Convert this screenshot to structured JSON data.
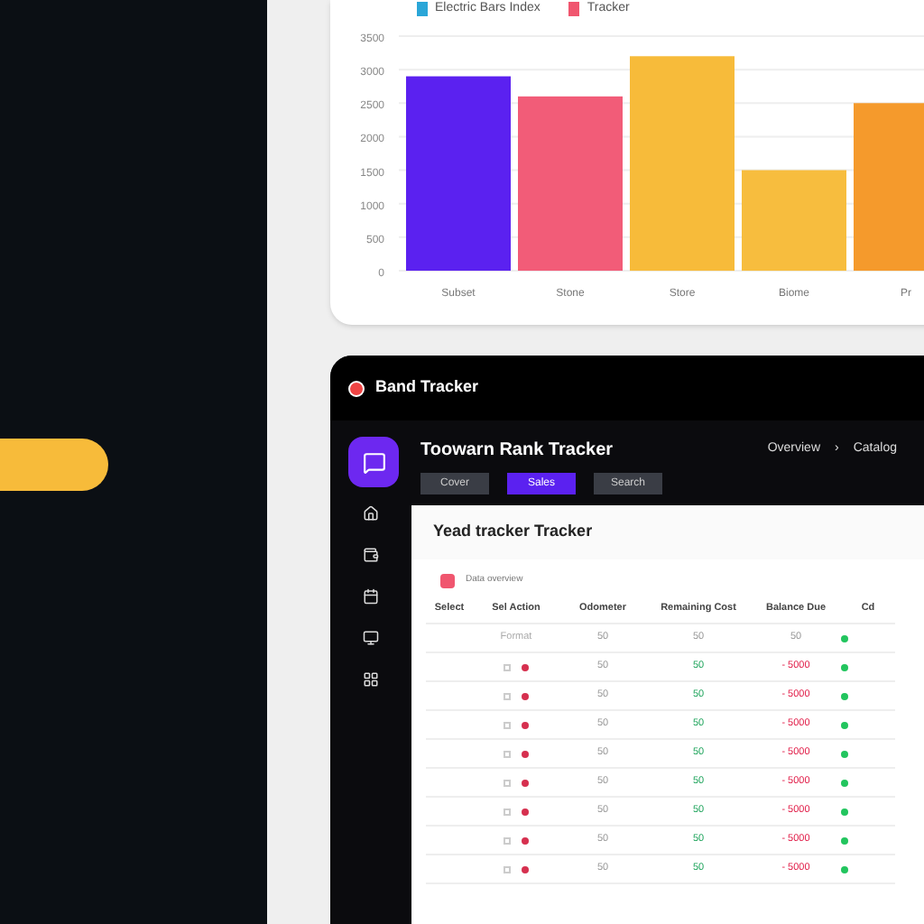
{
  "chart_card": {
    "legend": [
      {
        "label": "Electric Bars Index",
        "color": "#2aa6d8"
      }
    ],
    "series_swatch": {
      "color": "#f0566f"
    },
    "bars": [
      {
        "color": "#5b21f0"
      },
      {
        "color": "#f25c78"
      },
      {
        "color": "#f7bb3a"
      },
      {
        "color": "#f7bd3e"
      },
      {
        "color": "#f59a2c"
      }
    ],
    "chart_data": {
      "type": "bar",
      "categories": [
        "Subset",
        "Stone",
        "Store",
        "Biome",
        "Pr"
      ],
      "series": [
        {
          "name": "Tracker",
          "values": [
            2900,
            2600,
            3200,
            1500,
            2500
          ]
        }
      ],
      "ylim": [
        0,
        3500
      ],
      "yticks": [
        0,
        500,
        1000,
        1500,
        2000,
        2500,
        3000,
        3500
      ],
      "grid": true
    }
  },
  "window": {
    "title": "Band Tracker",
    "app_title": "Toowarn Rank Tracker",
    "buttons": [
      {
        "label": "Cover",
        "selected": false
      },
      {
        "label": "Sales",
        "selected": true
      },
      {
        "label": "Search",
        "selected": false
      }
    ],
    "breadcrumb": [
      "Overview",
      "›",
      "Catalog"
    ],
    "panel": {
      "title": "Yead tracker Tracker",
      "section": "Data overview",
      "columns": [
        "Select",
        "Sel Action",
        "Odometer",
        "Remaining Cost",
        "Balance Due",
        "Cd"
      ],
      "first_row": {
        "cells": [
          "",
          "Format",
          "50",
          "50",
          "50"
        ]
      },
      "rows": [
        {
          "checked": false,
          "cells": [
            "",
            "",
            "50",
            "50",
            "- 5000"
          ]
        },
        {
          "checked": false,
          "cells": [
            "",
            "",
            "50",
            "50",
            "- 5000"
          ]
        },
        {
          "checked": false,
          "cells": [
            "",
            "",
            "50",
            "50",
            "- 5000"
          ]
        },
        {
          "checked": false,
          "cells": [
            "",
            "",
            "50",
            "50",
            "- 5000"
          ]
        },
        {
          "checked": false,
          "cells": [
            "",
            "",
            "50",
            "50",
            "- 5000"
          ]
        },
        {
          "checked": false,
          "cells": [
            "",
            "",
            "50",
            "50",
            "- 5000"
          ]
        },
        {
          "checked": false,
          "cells": [
            "",
            "",
            "50",
            "50",
            "- 5000"
          ]
        },
        {
          "checked": false,
          "cells": [
            "",
            "",
            "50",
            "50",
            "- 5000"
          ]
        }
      ]
    }
  }
}
